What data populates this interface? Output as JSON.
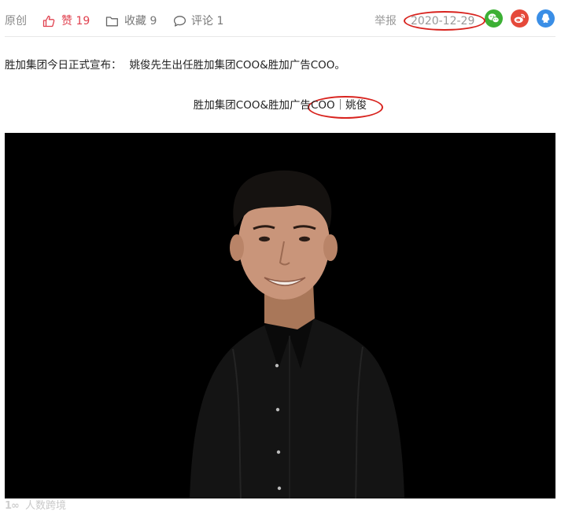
{
  "meta": {
    "original_label": "原创",
    "like_label": "赞 19",
    "favorite_label": "收藏 9",
    "comment_label": "评论 1",
    "report_label": "举报",
    "date": "2020-12-29"
  },
  "share_icons": [
    "wechat-icon",
    "weibo-icon",
    "qq-icon"
  ],
  "colors": {
    "like": "#e0404e",
    "wechat": "#3cb034",
    "weibo": "#e5493a",
    "qq": "#3a8ee6",
    "annotation": "#d8231e"
  },
  "article": {
    "announcement_prefix": "胜加集团今日正式宣布：",
    "announcement_body": "姚俊先生出任胜加集团COO&胜加广告COO。",
    "caption": "胜加集团COO&胜加广告COO｜姚俊"
  },
  "watermark": {
    "mark": "1∞",
    "text": "人数跨境"
  }
}
